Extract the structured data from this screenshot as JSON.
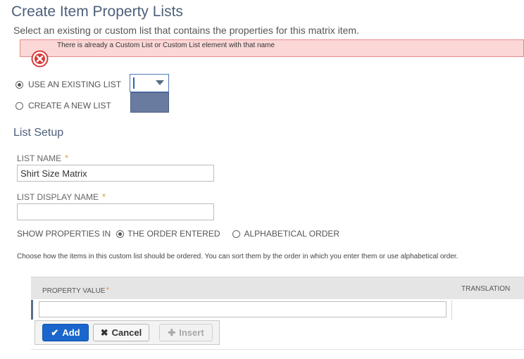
{
  "page": {
    "title": "Create Item Property Lists",
    "subtitle": "Select an existing or custom list that contains the properties for this matrix item."
  },
  "error": {
    "message": "There is already a Custom List or Custom List element with that name"
  },
  "list_choice": {
    "use_existing_label": "USE AN EXISTING LIST",
    "create_new_label": "CREATE A NEW LIST",
    "selected": "use_existing",
    "select_value": ""
  },
  "setup": {
    "section_title": "List Setup",
    "list_name_label": "LIST NAME",
    "list_name_value": "Shirt Size Matrix",
    "display_name_label": "LIST DISPLAY NAME",
    "display_name_value": "",
    "required_mark": "*",
    "show_properties_label": "SHOW PROPERTIES IN",
    "order_entered_label": "THE ORDER ENTERED",
    "alphabetical_label": "ALPHABETICAL ORDER",
    "order_selected": "order_entered",
    "help_text": "Choose how the items in this custom list should be ordered. You can sort them by the order in which you enter them or use alphabetical order."
  },
  "grid": {
    "columns": [
      "PROPERTY VALUE",
      "TRANSLATION"
    ],
    "required_mark": "*",
    "row_value": ""
  },
  "buttons": {
    "add": "Add",
    "cancel": "Cancel",
    "insert": "Insert"
  },
  "colors": {
    "accent": "#1a66cc",
    "error_bg": "#fcd7d7",
    "required": "#e19c4a",
    "title": "#4d5f79"
  }
}
